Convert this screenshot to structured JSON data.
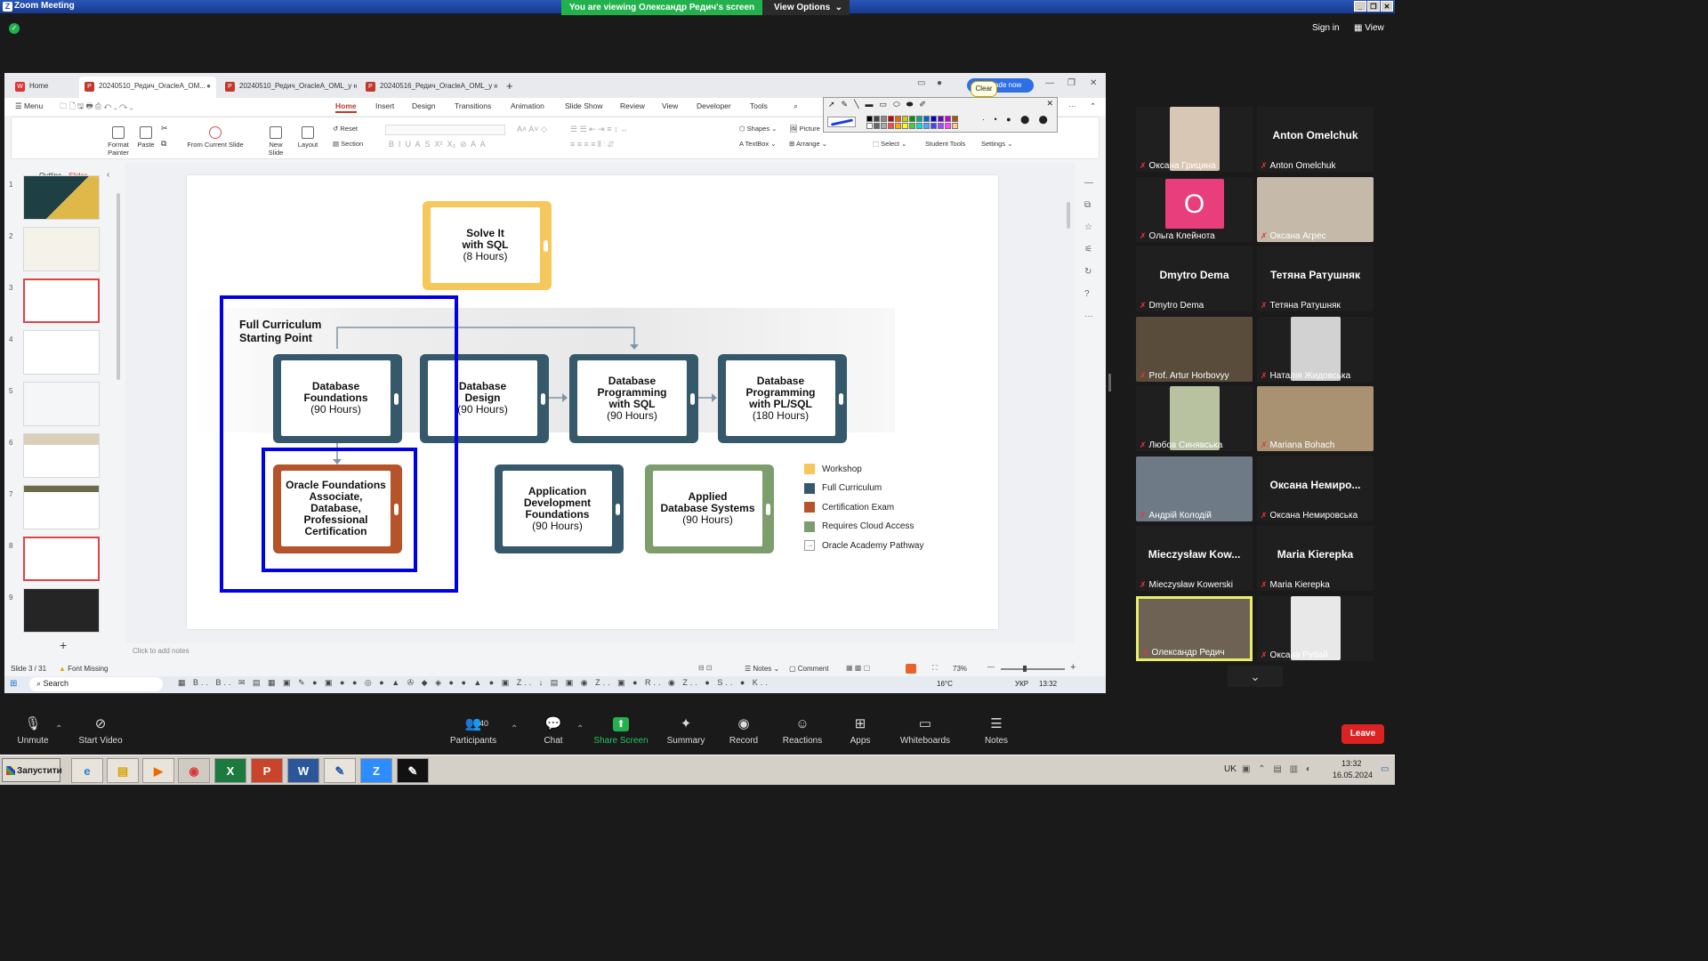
{
  "zoom": {
    "window_title": "Zoom Meeting",
    "viewing_banner": "You are viewing Олександр Редич's screen",
    "view_options": "View Options",
    "sign_in": "Sign in",
    "view": "View",
    "leave": "Leave",
    "controls": [
      {
        "label": "Unmute",
        "icon": "mic-off-icon"
      },
      {
        "label": "Start Video",
        "icon": "video-off-icon"
      },
      {
        "label": "Participants",
        "icon": "participants-icon",
        "count": "40"
      },
      {
        "label": "Chat",
        "icon": "chat-icon"
      },
      {
        "label": "Share Screen",
        "icon": "share-screen-icon"
      },
      {
        "label": "Summary",
        "icon": "summary-icon"
      },
      {
        "label": "Record",
        "icon": "record-icon"
      },
      {
        "label": "Reactions",
        "icon": "reactions-icon"
      },
      {
        "label": "Apps",
        "icon": "apps-icon"
      },
      {
        "label": "Whiteboards",
        "icon": "whiteboards-icon"
      },
      {
        "label": "Notes",
        "icon": "notes-icon"
      }
    ],
    "participants": [
      {
        "name": "Оксана Грицина",
        "big": ""
      },
      {
        "name": "Anton Omelchuk",
        "big": "Anton Omelchuk"
      },
      {
        "name": "Ольга Клейнота",
        "big": "O"
      },
      {
        "name": "Оксана Агрес",
        "big": ""
      },
      {
        "name": "Dmytro Dema",
        "big": "Dmytro Dema"
      },
      {
        "name": "Тетяна Ратушняк",
        "big": "Тетяна Ратушняк"
      },
      {
        "name": "Prof. Artur Horbovyy",
        "big": ""
      },
      {
        "name": "Наталія Жидовська",
        "big": ""
      },
      {
        "name": "Любов Синявська",
        "big": ""
      },
      {
        "name": "Mariana Bohach",
        "big": ""
      },
      {
        "name": "Андрій Колодій",
        "big": ""
      },
      {
        "name": "Оксана Немировська",
        "big": "Оксана  Немиро..."
      },
      {
        "name": "Mieczysław Kowerski",
        "big": "Mieczysław  Kow..."
      },
      {
        "name": "Maria Kierepka",
        "big": "Maria Kierepka"
      },
      {
        "name": "Олександр Редич",
        "big": ""
      },
      {
        "name": "Оксана Рубай",
        "big": ""
      }
    ]
  },
  "wps": {
    "tabs": [
      {
        "label": "Home"
      },
      {
        "label": "20240510_Редич_OracleA_OM..."
      },
      {
        "label": "20240510_Редич_OracleA_OML_у нав"
      },
      {
        "label": "20240516_Редич_OracleA_OML_у нав"
      }
    ],
    "upgrade": "Upgrade now",
    "clear_tooltip": "Clear",
    "menu_items": [
      "Menu",
      "Home",
      "Insert",
      "Design",
      "Transitions",
      "Animation",
      "Slide Show",
      "Review",
      "View",
      "Developer",
      "Tools"
    ],
    "ribbon": {
      "format_painter": "Format Painter",
      "paste": "Paste",
      "from_current_slide": "From Current Slide",
      "new_slide": "New Slide",
      "layout": "Layout",
      "reset": "Reset",
      "section": "Section",
      "shapes": "Shapes",
      "picture": "Picture",
      "textbox": "TextBox",
      "arrange": "Arrange",
      "select": "Select",
      "student_tools": "Student Tools",
      "settings": "Settings"
    },
    "panel_tabs": [
      "Outline",
      "Slides"
    ],
    "slide_numbers": [
      "1",
      "2",
      "3",
      "4",
      "5",
      "6",
      "7",
      "8",
      "9"
    ],
    "notes_placeholder": "Click to add notes",
    "status": {
      "slide": "Slide 3 / 31",
      "font_missing": "Font Missing",
      "notes": "Notes",
      "comment": "Comment",
      "zoom": "73%"
    },
    "taskbar": {
      "search": "Search",
      "temp": "16°C",
      "lang": "УКР",
      "time": "13:32"
    }
  },
  "slide": {
    "cards": [
      {
        "title": "Solve It\nwith SQL",
        "hours": "(8 Hours)",
        "kind": "workshop"
      },
      {
        "title": "Database\nFoundations",
        "hours": "(90 Hours)",
        "kind": "full"
      },
      {
        "title": "Database\nDesign",
        "hours": "(90 Hours)",
        "kind": "full"
      },
      {
        "title": "Database\nProgramming\nwith SQL",
        "hours": "(90 Hours)",
        "kind": "full"
      },
      {
        "title": "Database\nProgramming\nwith PL/SQL",
        "hours": "(180 Hours)",
        "kind": "full"
      },
      {
        "title": "Oracle Foundations\nAssociate,\nDatabase,\nProfessional\nCertification",
        "hours": "",
        "kind": "cert"
      },
      {
        "title": "Application\nDevelopment\nFoundations",
        "hours": "(90 Hours)",
        "kind": "full"
      },
      {
        "title": "Applied\nDatabase Systems",
        "hours": "(90 Hours)",
        "kind": "cloud"
      }
    ],
    "starting_point": "Full Curriculum\nStarting Point",
    "legend": [
      {
        "label": "Workshop",
        "color": "#f6c75b"
      },
      {
        "label": "Full Curriculum",
        "color": "#35586b"
      },
      {
        "label": "Certification Exam",
        "color": "#b5532b"
      },
      {
        "label": "Requires Cloud Access",
        "color": "#7d9e6c"
      },
      {
        "label": "Oracle Academy Pathway",
        "color": "arrow"
      }
    ],
    "colors": {
      "workshop": "#f6c75b",
      "full": "#35586b",
      "cert": "#b5532b",
      "cloud": "#7d9e6c",
      "highlight": "#0000e6"
    }
  },
  "xp": {
    "start": "Запустити",
    "lang": "UK",
    "time": "13:32",
    "date": "16.05.2024"
  }
}
